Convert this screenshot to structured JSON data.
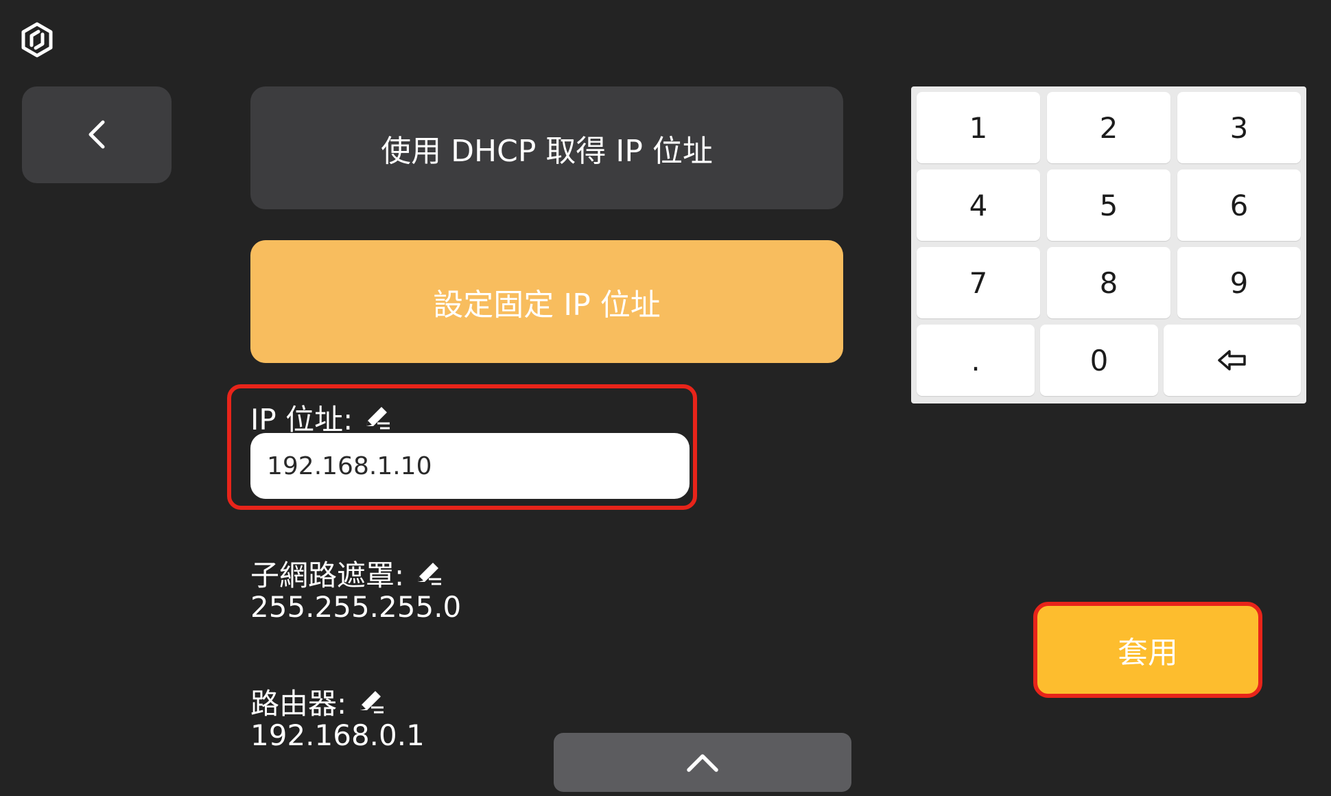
{
  "header": {
    "logo_icon": "device-logo-icon"
  },
  "nav": {
    "back_icon": "chevron-left-icon"
  },
  "ip_mode": {
    "dhcp_label": "使用 DHCP 取得 IP 位址",
    "static_label": "設定固定 IP 位址",
    "selected": "static"
  },
  "fields": {
    "ip_address": {
      "label": "IP 位址:",
      "value": "192.168.1.10",
      "edit_icon": "pencil-icon"
    },
    "subnet_mask": {
      "label": "子網路遮罩:",
      "value": "255.255.255.0",
      "edit_icon": "pencil-icon"
    },
    "router": {
      "label": "路由器:",
      "value": "192.168.0.1",
      "edit_icon": "pencil-icon"
    }
  },
  "keypad": {
    "keys": [
      "1",
      "2",
      "3",
      "4",
      "5",
      "6",
      "7",
      "8",
      "9",
      ".",
      "0"
    ],
    "backspace_icon": "backspace-arrow-icon"
  },
  "actions": {
    "apply_label": "套用",
    "scroll_up_icon": "chevron-up-icon"
  },
  "colors": {
    "background": "#232323",
    "button_dark": "#3d3d3f",
    "accent_light": "#f8bd5e",
    "accent_strong": "#fdbd2e",
    "highlight": "#e8241a"
  }
}
